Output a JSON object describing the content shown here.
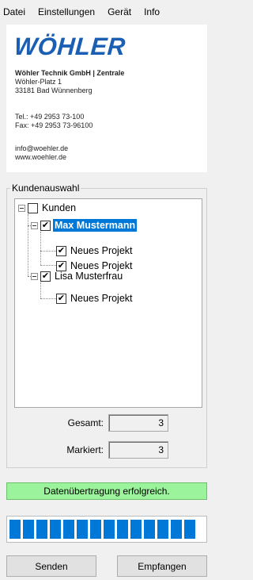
{
  "menu": [
    "Datei",
    "Einstellungen",
    "Gerät",
    "Info"
  ],
  "company": {
    "logo_text": "WÖHLER",
    "firm": "Wöhler Technik GmbH | Zentrale",
    "street": "Wöhler-Platz 1",
    "city": "33181 Bad Wünnenberg",
    "tel": "Tel.: +49 2953 73-100",
    "fax": "Fax: +49 2953 73-96100",
    "email": "info@woehler.de",
    "web": "www.woehler.de",
    "brand_color": "#1a5fb4"
  },
  "customer_selection": {
    "title": "Kundenauswahl",
    "tree": {
      "root": "Kunden",
      "customers": [
        {
          "name": "Max Mustermann",
          "checked": true,
          "selected": true,
          "projects": [
            "Neues Projekt",
            "Neues Projekt"
          ]
        },
        {
          "name": "Lisa Musterfrau",
          "checked": true,
          "selected": false,
          "projects": [
            "Neues Projekt"
          ]
        }
      ]
    },
    "total_label": "Gesamt:",
    "total_value": "3",
    "marked_label": "Markiert:",
    "marked_value": "3"
  },
  "status": {
    "text": "Datenübertragung erfolgreich.",
    "color": "#9bf39b"
  },
  "progress": {
    "percent": 100,
    "color": "#0078d7"
  },
  "buttons": {
    "send": "Senden",
    "receive": "Empfangen"
  }
}
